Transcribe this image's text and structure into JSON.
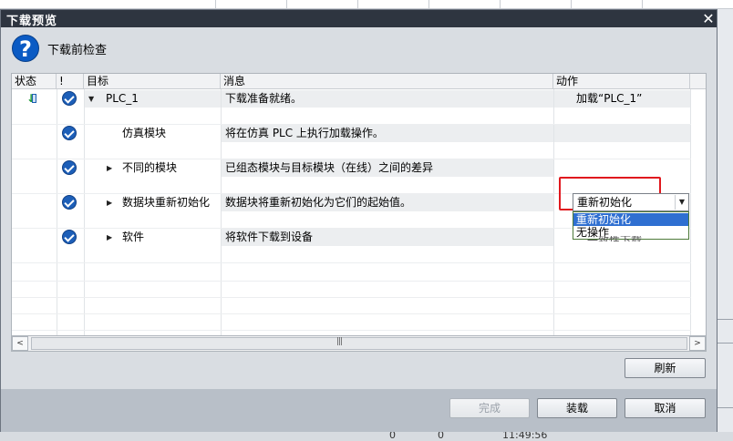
{
  "dialog": {
    "title": "下载预览",
    "close_glyph": "✕",
    "header_title": "下载前检查"
  },
  "table": {
    "columns": [
      "状态",
      "!",
      "目标",
      "消息",
      "动作"
    ],
    "rows": [
      {
        "target": "PLC_1",
        "message": "下载准备就绪。",
        "action": "加载“PLC_1”"
      },
      {
        "target": "仿真模块",
        "message": "将在仿真 PLC 上执行加载操作。",
        "action": ""
      },
      {
        "target": "不同的模块",
        "message": "已组态模块与目标模块（在线）之间的差异",
        "action": ""
      },
      {
        "target": "数据块重新初始化",
        "message": "数据块将重新初始化为它们的起始值。",
        "action": ""
      },
      {
        "target": "软件",
        "message": "将软件下载到设备",
        "action": ""
      }
    ]
  },
  "dropdown": {
    "selected": "重新初始化",
    "options": [
      "重新初始化",
      "无操作"
    ],
    "ghost_text": "一致性下载"
  },
  "scrollbar": {
    "grip": "|||",
    "left_arrow": "<",
    "right_arrow": ">"
  },
  "buttons": {
    "refresh": "刷新",
    "finish": "完成",
    "load": "装载",
    "cancel": "取消"
  },
  "statusbar": {
    "v1": "0",
    "v2": "0",
    "time": "11:49:56"
  }
}
